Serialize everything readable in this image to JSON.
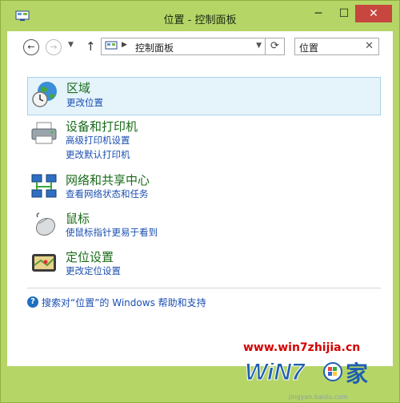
{
  "window": {
    "title": "位置 - 控制面板",
    "min_label": "─",
    "max_label": "☐",
    "close_label": "✕"
  },
  "toolbar": {
    "back": "←",
    "forward": "→",
    "recent": "▼",
    "up": "↑",
    "address_sep": "▶",
    "address": "控制面板",
    "address_dropdown": "▼",
    "refresh": "⟳"
  },
  "search": {
    "value": "位置",
    "clear": "✕"
  },
  "items": [
    {
      "title": "区域",
      "icon": "globe-clock-icon",
      "links": [
        "更改位置"
      ]
    },
    {
      "title": "设备和打印机",
      "icon": "printer-icon",
      "links": [
        "高级打印机设置",
        "更改默认打印机"
      ]
    },
    {
      "title": "网络和共享中心",
      "icon": "network-icon",
      "links": [
        "查看网络状态和任务"
      ]
    },
    {
      "title": "鼠标",
      "icon": "mouse-icon",
      "links": [
        "使鼠标指针更易于看到"
      ]
    },
    {
      "title": "定位设置",
      "icon": "location-icon",
      "links": [
        "更改定位设置"
      ]
    }
  ],
  "help": {
    "icon": "?",
    "text": "搜索对“位置”的 Windows 帮助和支持"
  },
  "watermark": {
    "url": "www.win7zhijia.cn",
    "brand": "WiN7之家",
    "sub": "jingyan.baidu.com"
  },
  "colors": {
    "title_bar": "#b5d567",
    "link": "#1b4fb0",
    "heading": "#1a6b1a",
    "selected_bg": "#e5f3fb",
    "close": "#c7463e"
  }
}
